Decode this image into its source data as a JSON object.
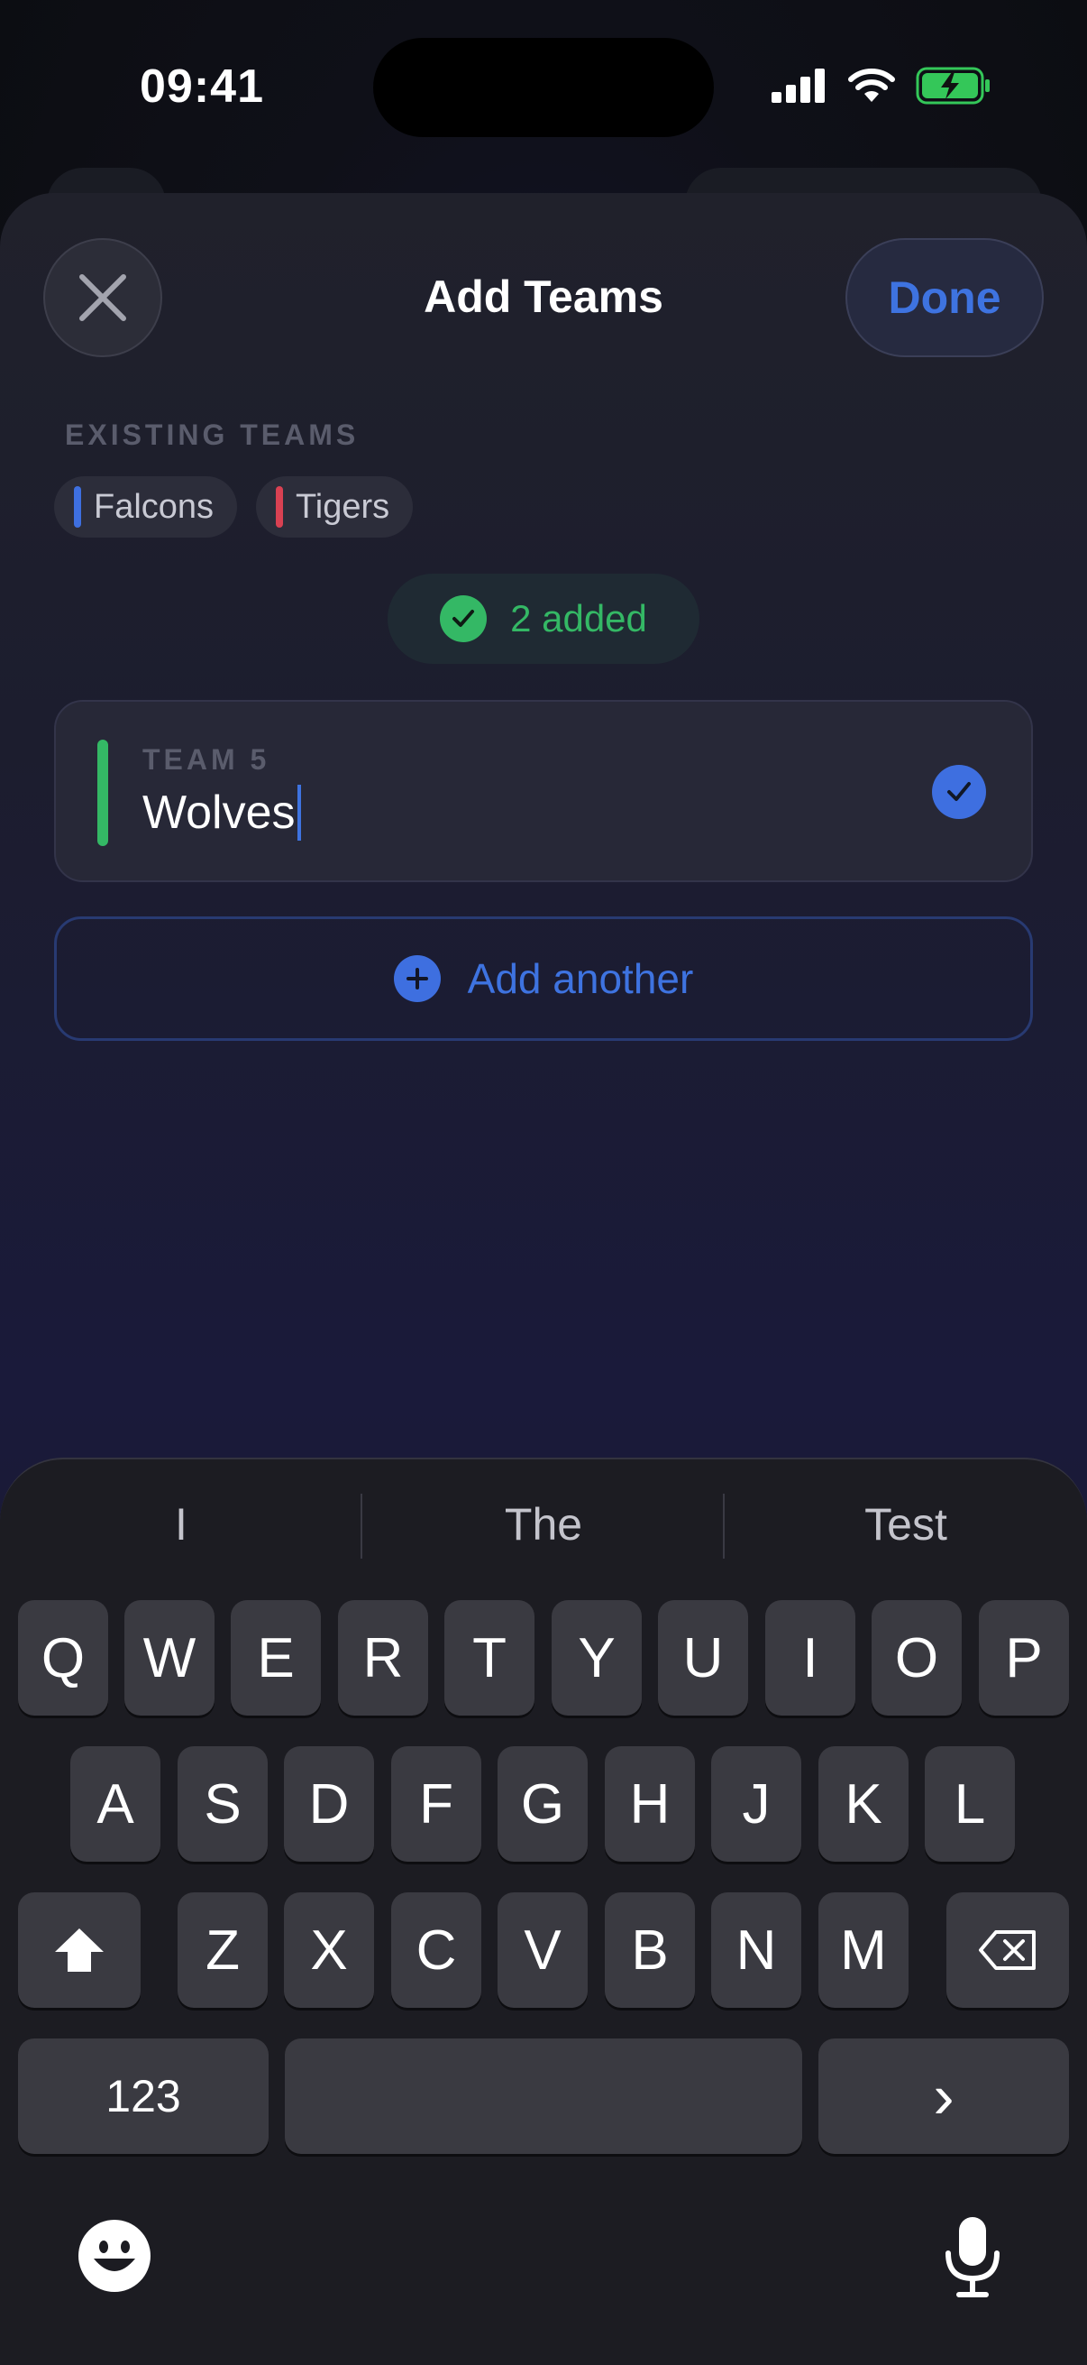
{
  "status_bar": {
    "time": "09:41"
  },
  "sheet": {
    "title": "Add Teams",
    "done_label": "Done",
    "existing_label": "EXISTING TEAMS",
    "existing_teams": [
      {
        "name": "Falcons",
        "color": "#3e6fe0"
      },
      {
        "name": "Tigers",
        "color": "#d94152"
      }
    ],
    "added_count_text": "2 added",
    "new_team": {
      "label": "TEAM 5",
      "value": "Wolves",
      "color": "#34b865"
    },
    "add_another_label": "Add another"
  },
  "keyboard": {
    "suggestions": [
      "I",
      "The",
      "Test"
    ],
    "row1": [
      "Q",
      "W",
      "E",
      "R",
      "T",
      "Y",
      "U",
      "I",
      "O",
      "P"
    ],
    "row2": [
      "A",
      "S",
      "D",
      "F",
      "G",
      "H",
      "J",
      "K",
      "L"
    ],
    "row3": [
      "Z",
      "X",
      "C",
      "V",
      "B",
      "N",
      "M"
    ],
    "numbers_label": "123",
    "return_glyph": "›"
  },
  "colors": {
    "accent": "#3e73e0",
    "success": "#34b865"
  }
}
